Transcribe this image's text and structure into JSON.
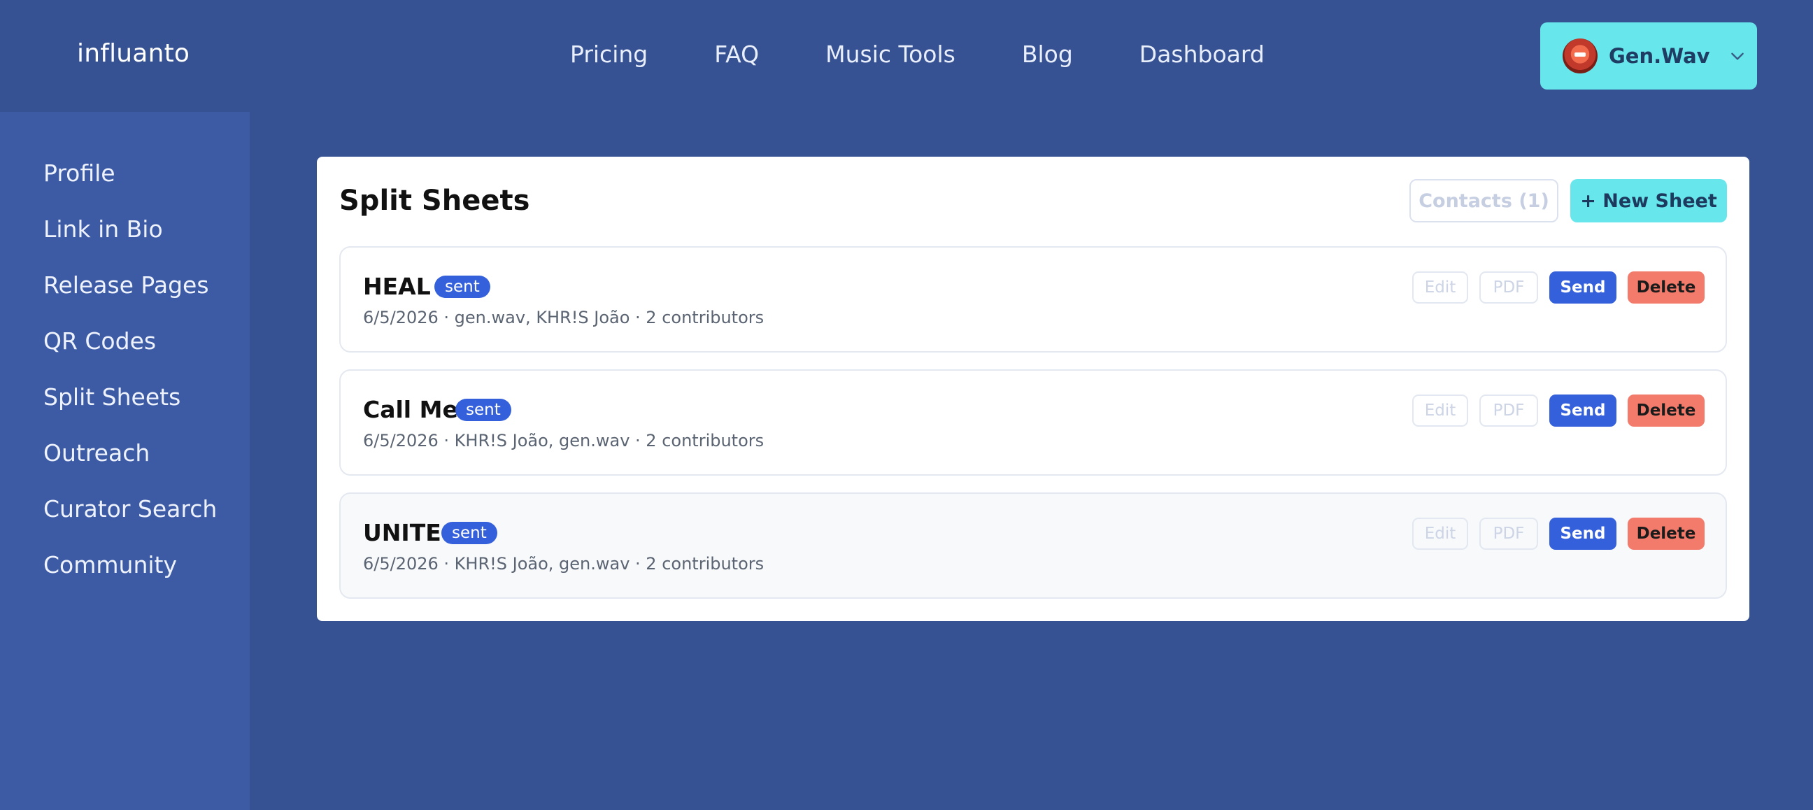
{
  "header": {
    "brand": "influanto",
    "nav": [
      "Pricing",
      "FAQ",
      "Music Tools",
      "Blog",
      "Dashboard"
    ],
    "user": {
      "name": "Gen.Wav",
      "accent": "#67e6ec"
    }
  },
  "sidebar": {
    "items": [
      "Profile",
      "Link in Bio",
      "Release Pages",
      "QR Codes",
      "Split Sheets",
      "Outreach",
      "Curator Search",
      "Community"
    ]
  },
  "main": {
    "title": "Split Sheets",
    "contacts_label": "Contacts (1)",
    "new_sheet_label": "+ New Sheet",
    "sheets": [
      {
        "name": "HEAL",
        "status": "sent",
        "meta": "6/5/2026 · gen.wav, KHR!S João · 2 contributors"
      },
      {
        "name": "Call Me",
        "status": "sent",
        "meta": "6/5/2026 · KHR!S João, gen.wav · 2 contributors"
      },
      {
        "name": "UNITE",
        "status": "sent",
        "meta": "6/5/2026 · KHR!S João, gen.wav · 2 contributors"
      }
    ],
    "actions": {
      "edit": "Edit",
      "pdf": "PDF",
      "send": "Send",
      "delete": "Delete"
    }
  },
  "colors": {
    "background": "#375292",
    "sidebar": "#3d5ba4",
    "primary": "#3560db",
    "danger": "#f27b6b",
    "accent": "#67e6ec"
  },
  "icons": {
    "user_menu": "chevron-down-icon",
    "avatar": "avatar-image"
  }
}
